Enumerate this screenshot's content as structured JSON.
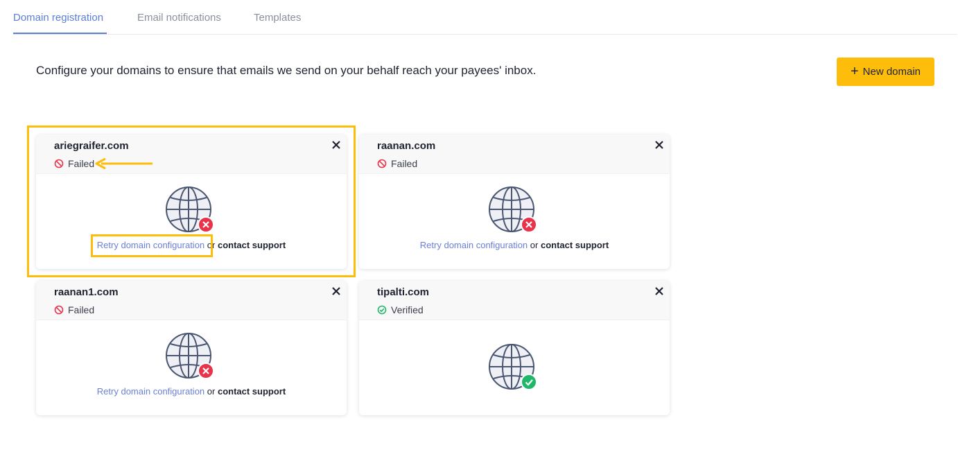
{
  "tabs": [
    {
      "label": "Domain registration",
      "active": true
    },
    {
      "label": "Email notifications",
      "active": false
    },
    {
      "label": "Templates",
      "active": false
    }
  ],
  "intro_text": "Configure your domains to ensure that emails we send on your behalf reach your payees' inbox.",
  "new_domain_button": {
    "plus": "+",
    "label": "New domain"
  },
  "colors": {
    "accent": "#fdbd0a",
    "link": "#6b7fd9",
    "failed": "#e8334a",
    "verified": "#1fb86a",
    "tab_active": "#5b7fd6"
  },
  "domains": [
    {
      "name": "ariegraifer.com",
      "status": "Failed",
      "retry_label": "Retry domain configuration",
      "or_text": "or",
      "contact_label": "contact support",
      "icon": "globe-failed-icon"
    },
    {
      "name": "raanan.com",
      "status": "Failed",
      "retry_label": "Retry domain configuration",
      "or_text": "or",
      "contact_label": "contact support",
      "icon": "globe-failed-icon"
    },
    {
      "name": "raanan1.com",
      "status": "Failed",
      "retry_label": "Retry domain configuration",
      "or_text": "or",
      "contact_label": "contact support",
      "icon": "globe-failed-icon"
    },
    {
      "name": "tipalti.com",
      "status": "Verified",
      "icon": "globe-verified-icon"
    }
  ]
}
